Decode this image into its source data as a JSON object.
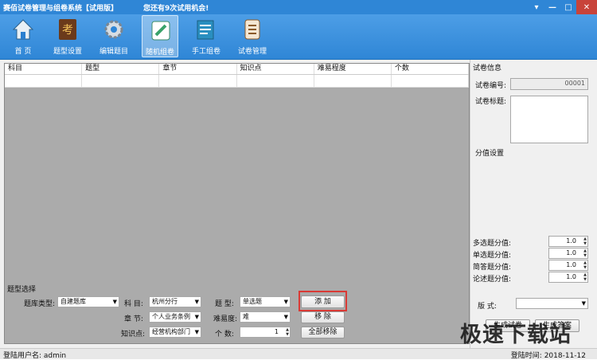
{
  "window": {
    "title": "赛佰试卷管理与组卷系统【试用版】",
    "trial_notice": "您还有9次试用机会!"
  },
  "toolbar": {
    "items": [
      {
        "label": "首 页"
      },
      {
        "label": "题型设置"
      },
      {
        "label": "编辑题目"
      },
      {
        "label": "随机组卷"
      },
      {
        "label": "手工组卷"
      },
      {
        "label": "试卷管理"
      }
    ]
  },
  "grid": {
    "columns": [
      "科目",
      "题型",
      "章节",
      "知识点",
      "难易程度",
      "个数"
    ]
  },
  "paper_info": {
    "section": "试卷信息",
    "id_label": "试卷编号:",
    "id_value": "00001",
    "title_label": "试卷标题:",
    "score_section": "分值设置"
  },
  "scores": [
    {
      "label": "多选题分值:",
      "value": "1.0"
    },
    {
      "label": "单选题分值:",
      "value": "1.0"
    },
    {
      "label": "简答题分值:",
      "value": "1.0"
    },
    {
      "label": "论述题分值:",
      "value": "1.0"
    }
  ],
  "layout_ctl": {
    "label": "版 式:",
    "value": ""
  },
  "selection": {
    "section": "题型选择",
    "bank_label": "题库类型:",
    "bank_value": "自建题库",
    "subject_label": "科 目:",
    "subject_value": "杭州分行",
    "type_label": "题 型:",
    "type_value": "单选题",
    "chapter_label": "章 节:",
    "chapter_value": "个人业务条例",
    "difficulty_label": "难易度:",
    "difficulty_value": "难",
    "knowledge_label": "知识点:",
    "knowledge_value": "经营机构部门",
    "count_label": "个 数:",
    "count_value": "1"
  },
  "buttons": {
    "add": "添 加",
    "remove": "移 除",
    "remove_all": "全部移除",
    "generate": "生成试卷",
    "answer": "生成答案"
  },
  "status": {
    "user": "登陆用户名: admin",
    "time": "登陆时间: 2018-11-12"
  },
  "watermark": "极速下载站"
}
